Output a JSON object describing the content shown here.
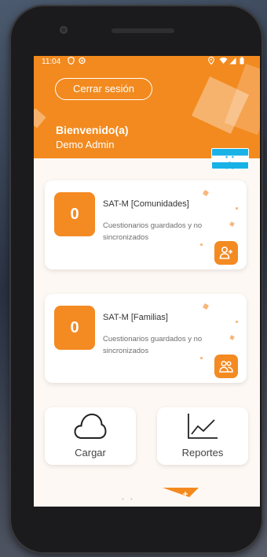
{
  "status_bar": {
    "time": "11:04",
    "icons_left": [
      "shield-icon",
      "record-icon"
    ],
    "icons_right": [
      "location-icon",
      "wifi-icon",
      "signal-icon",
      "battery-icon"
    ]
  },
  "header": {
    "logout_label": "Cerrar sesión",
    "welcome": "Bienvenido(a)",
    "user": "Demo Admin",
    "flag": "honduras-flag"
  },
  "cards": [
    {
      "count": "0",
      "title": "SAT-M [Comunidades]",
      "description": "Cuestionarios guardados y no sincronizados",
      "icon": "add-user-icon"
    },
    {
      "count": "0",
      "title": "SAT-M [Familias]",
      "description": "Cuestionarios guardados y no sincronizados",
      "icon": "group-icon"
    }
  ],
  "actions": {
    "upload_label": "Cargar",
    "upload_icon": "cloud-icon",
    "reports_label": "Reportes",
    "reports_icon": "line-chart-icon"
  },
  "colors": {
    "accent": "#f28a1f",
    "background": "#fdf8f3",
    "flag_blue": "#18b2e6"
  }
}
